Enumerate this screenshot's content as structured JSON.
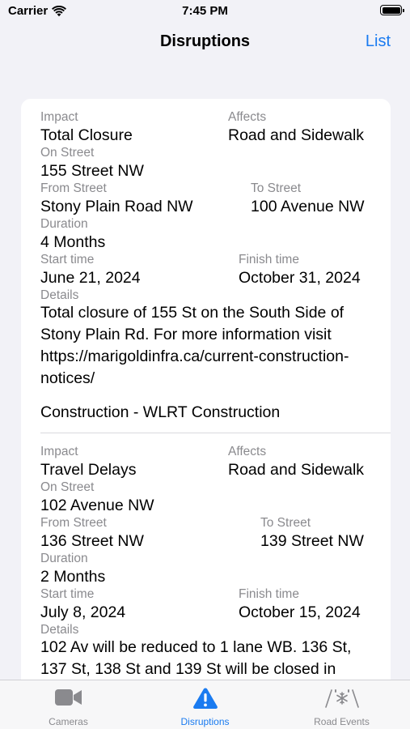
{
  "status_bar": {
    "carrier": "Carrier",
    "time": "7:45 PM"
  },
  "nav": {
    "title": "Disruptions",
    "right_button": "List"
  },
  "labels": {
    "impact": "Impact",
    "affects": "Affects",
    "on_street": "On Street",
    "from_street": "From Street",
    "to_street": "To Street",
    "duration": "Duration",
    "start_time": "Start time",
    "finish_time": "Finish time",
    "details": "Details"
  },
  "disruptions": [
    {
      "impact": "Total Closure",
      "affects": "Road and Sidewalk",
      "on_street": "155 Street NW",
      "from_street": "Stony Plain Road NW",
      "to_street": "100 Avenue NW",
      "duration": "4 Months",
      "start_time": "June 21, 2024",
      "finish_time": "October 31, 2024",
      "details": "Total closure of 155 St on the South Side of Stony Plain Rd. For more information visit https://marigoldinfra.ca/current-construction-notices/",
      "category": "Construction - WLRT Construction"
    },
    {
      "impact": "Travel Delays",
      "affects": "Road and Sidewalk",
      "on_street": "102 Avenue NW",
      "from_street": "136 Street NW",
      "to_street": "139 Street NW",
      "duration": "2 Months",
      "start_time": "July 8, 2024",
      "finish_time": "October 15, 2024",
      "details": "102 Av will be reduced to 1 lane WB. 136 St, 137 St, 138 St and 139 St will be closed in"
    }
  ],
  "tabs": [
    {
      "label": "Cameras",
      "icon": "video-camera-icon",
      "active": false
    },
    {
      "label": "Disruptions",
      "icon": "warning-triangle-icon",
      "active": true
    },
    {
      "label": "Road Events",
      "icon": "snow-road-icon",
      "active": false
    }
  ],
  "colors": {
    "accent": "#1a7bf0",
    "secondary_text": "#8a8a8e",
    "background": "#f2f2f7"
  }
}
